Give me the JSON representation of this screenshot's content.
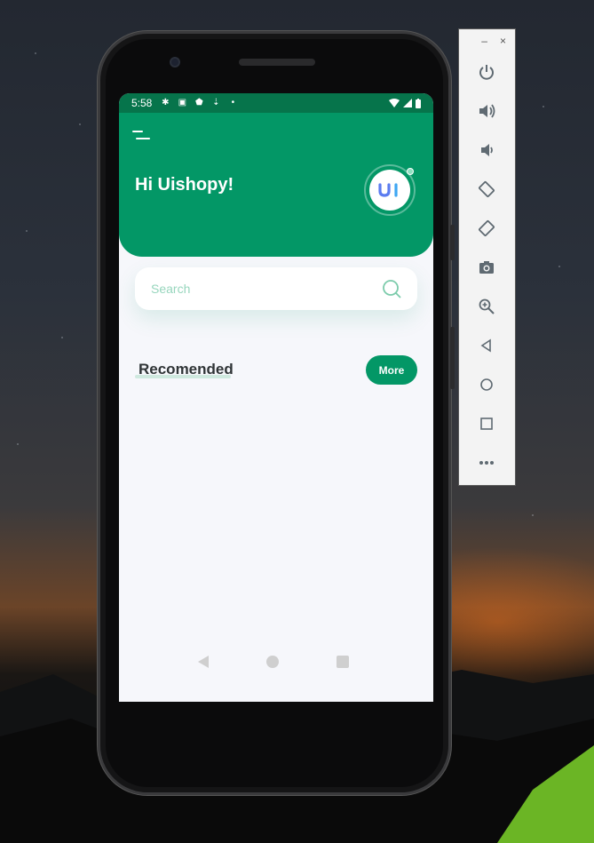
{
  "statusbar": {
    "time": "5:58"
  },
  "header": {
    "greeting": "Hi Uishopy!"
  },
  "search": {
    "placeholder": "Search"
  },
  "section": {
    "title": "Recomended",
    "more_label": "More"
  },
  "emulator": {
    "minimize": "–",
    "close": "×",
    "tools": [
      "power-icon",
      "volume-up-icon",
      "volume-down-icon",
      "rotate-left-icon",
      "rotate-right-icon",
      "camera-icon",
      "zoom-icon",
      "back-icon",
      "home-icon",
      "overview-icon",
      "more-icon"
    ]
  },
  "colors": {
    "brand_green": "#039766",
    "status_green": "#06744b",
    "screen_bg": "#f6f7fb"
  }
}
